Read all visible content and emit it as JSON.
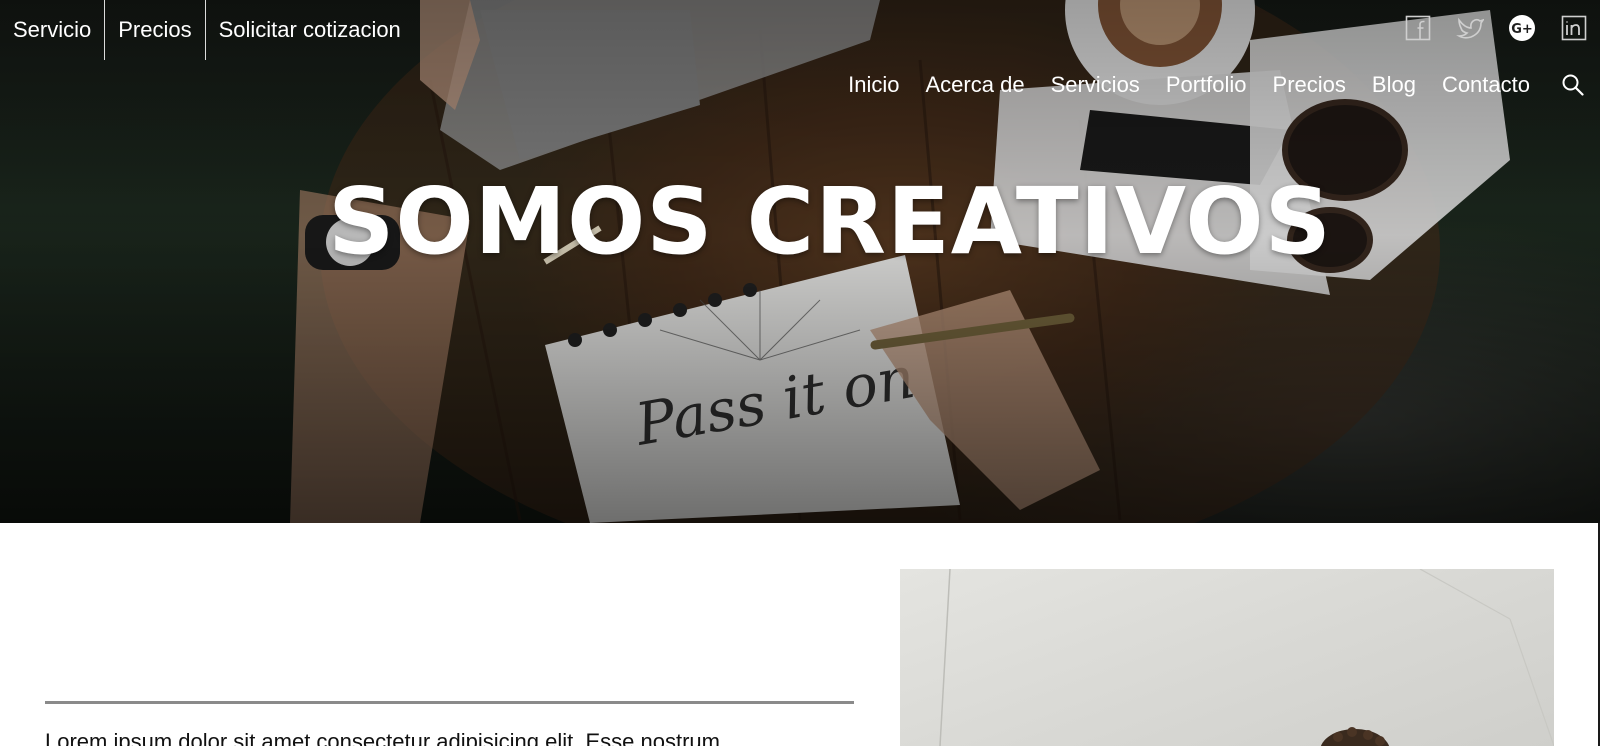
{
  "topbar": {
    "links": [
      "Servicio",
      "Precios",
      "Solicitar cotizacion"
    ]
  },
  "socials": [
    {
      "icon": "facebook-icon"
    },
    {
      "icon": "twitter-icon"
    },
    {
      "icon": "google-plus-icon",
      "label": "G+"
    },
    {
      "icon": "linkedin-icon"
    }
  ],
  "nav": {
    "links": [
      "Inicio",
      "Acerca de",
      "Servicios",
      "Portfolio",
      "Precios",
      "Blog",
      "Contacto"
    ],
    "search_icon": "search-icon"
  },
  "hero": {
    "headline": "SOMOS CREATIVOS"
  },
  "content": {
    "paragraph": "Lorem ipsum dolor sit amet consectetur adipisicing elit. Esse nostrum"
  },
  "colors": {
    "nav_text": "#ffffff",
    "divider": "#8a8a8a",
    "body_text": "#111111"
  }
}
